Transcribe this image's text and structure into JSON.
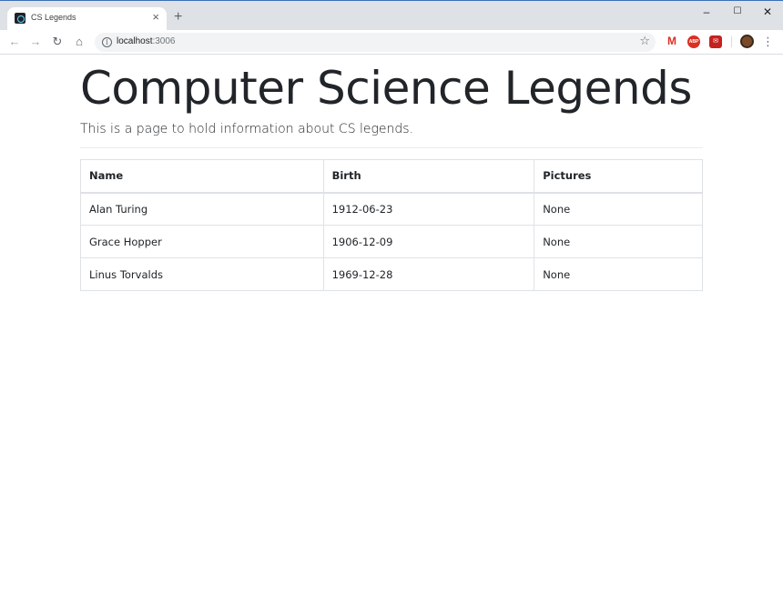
{
  "browser": {
    "tab_title": "CS Legends",
    "tab_close": "×",
    "new_tab": "+",
    "url_host": "localhost",
    "url_port": ":3006",
    "window_controls": {
      "minimize": "–",
      "maximize": "☐",
      "close": "✕"
    },
    "icons": [
      "react-favicon",
      "back-arrow-icon",
      "forward-arrow-icon",
      "reload-icon",
      "home-icon",
      "info-icon",
      "star-icon",
      "gmail-icon",
      "adblock-icon",
      "extension-icon",
      "avatar",
      "menu-icon"
    ]
  },
  "page": {
    "title": "Computer Science Legends",
    "lead": "This is a page to hold information about CS legends."
  },
  "table": {
    "headers": [
      "Name",
      "Birth",
      "Pictures"
    ],
    "rows": [
      [
        "Alan Turing",
        "1912-06-23",
        "None"
      ],
      [
        "Grace Hopper",
        "1906-12-09",
        "None"
      ],
      [
        "Linus Torvalds",
        "1969-12-28",
        "None"
      ]
    ]
  }
}
